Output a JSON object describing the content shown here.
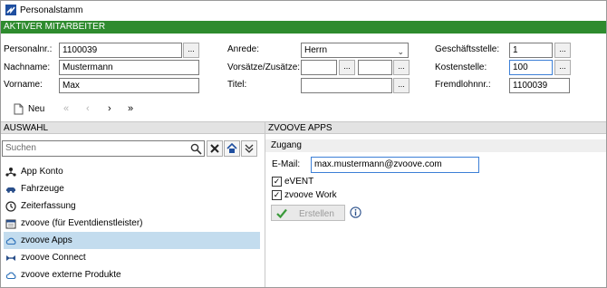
{
  "window": {
    "title": "Personalstamm"
  },
  "banner": {
    "text": "AKTIVER MITARBEITER"
  },
  "form": {
    "personalnr": {
      "label": "Personalnr.:",
      "value": "1100039"
    },
    "nachname": {
      "label": "Nachname:",
      "value": "Mustermann"
    },
    "vorname": {
      "label": "Vorname:",
      "value": "Max"
    },
    "anrede": {
      "label": "Anrede:",
      "value": "Herrn"
    },
    "vorsaetze": {
      "label": "Vorsätze/Zusätze:",
      "value1": "",
      "value2": ""
    },
    "titel": {
      "label": "Titel:",
      "value": ""
    },
    "geschaeftsstelle": {
      "label": "Geschäftsstelle:",
      "value": "1"
    },
    "kostenstelle": {
      "label": "Kostenstelle:",
      "value": "100"
    },
    "fremdlohnnr": {
      "label": "Fremdlohnnr.:",
      "value": "1100039"
    },
    "dots": "..."
  },
  "toolbar": {
    "new_label": "Neu",
    "first": "«",
    "prev": "‹",
    "next": "›",
    "last": "»"
  },
  "left_panel": {
    "header": "AUSWAHL",
    "search_placeholder": "Suchen",
    "items": [
      {
        "label": "App Konto",
        "icon": "app-konto-icon"
      },
      {
        "label": "Fahrzeuge",
        "icon": "car-icon"
      },
      {
        "label": "Zeiterfassung",
        "icon": "clock-icon"
      },
      {
        "label": "zvoove (für Eventdienstleister)",
        "icon": "calendar-icon"
      },
      {
        "label": "zvoove Apps",
        "icon": "cloud-icon"
      },
      {
        "label": "zvoove Connect",
        "icon": "connect-icon"
      },
      {
        "label": "zvoove externe Produkte",
        "icon": "cloud-icon"
      }
    ],
    "selected_index": 4
  },
  "right_panel": {
    "header": "ZVOOVE APPS",
    "section": "Zugang",
    "email_label": "E-Mail:",
    "email_value": "max.mustermann@zvoove.com",
    "event_label": "eVENT",
    "event_checked": true,
    "work_label": "zvoove Work",
    "work_checked": true,
    "create_label": "Erstellen",
    "info_icon": "info-icon"
  },
  "colors": {
    "green": "#2e8b2e",
    "selected": "#c3dcee",
    "focus": "#3c7fd6"
  }
}
